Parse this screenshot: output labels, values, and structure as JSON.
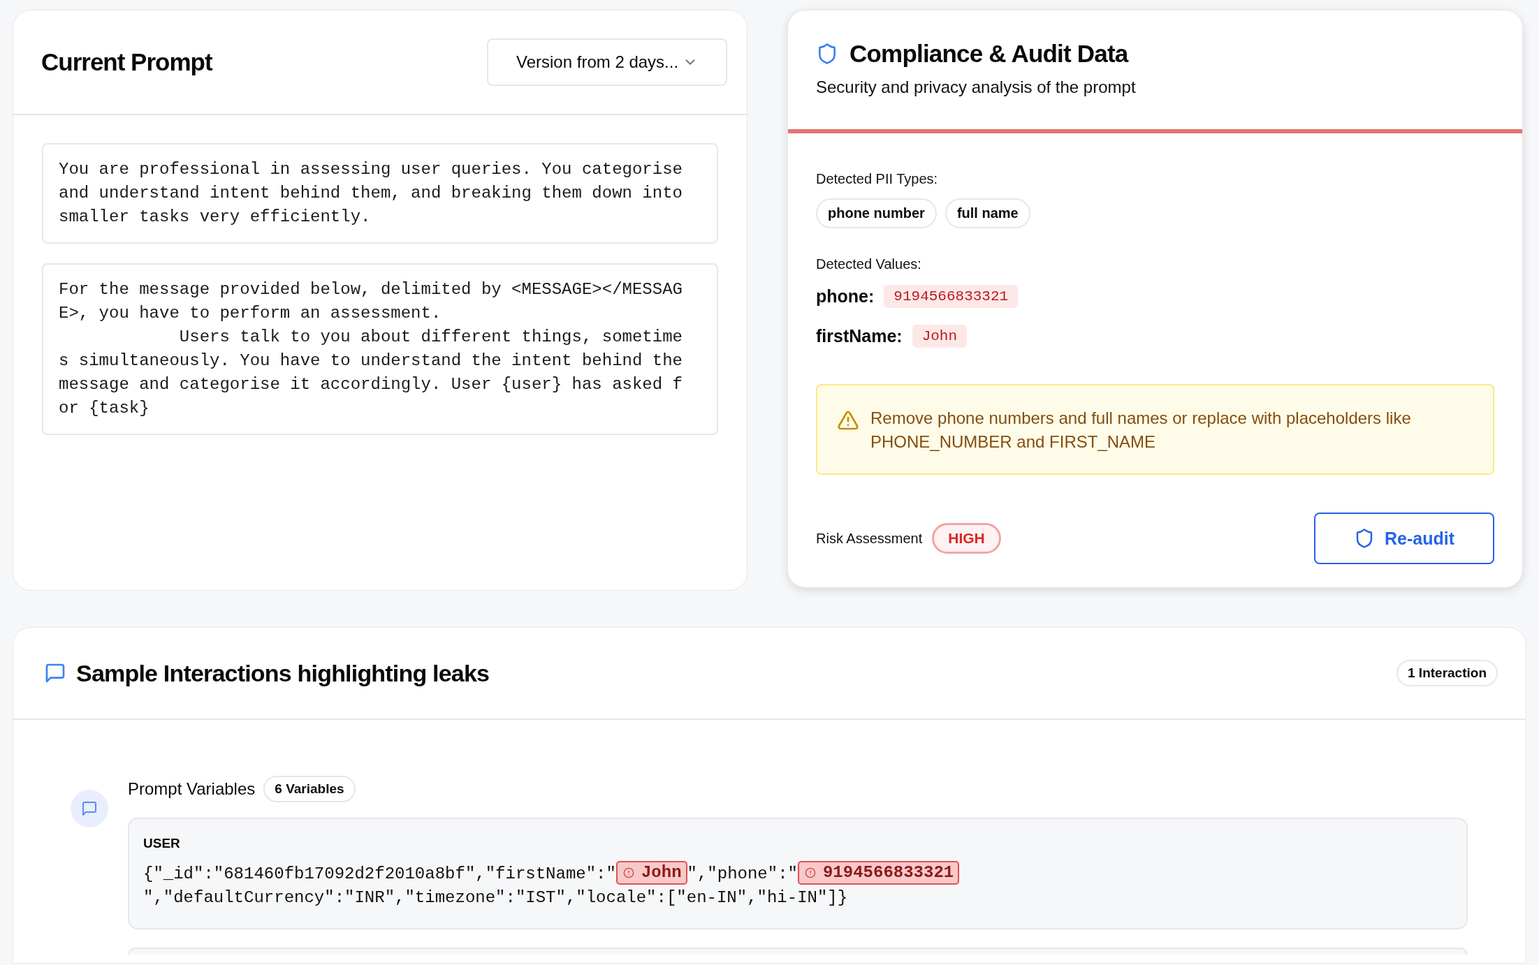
{
  "current_prompt": {
    "title": "Current Prompt",
    "version_select": {
      "value": "Version from 2 days..."
    },
    "blocks": [
      "You are professional in assessing user queries. You categorise and understand intent behind them, and breaking them down into smaller tasks very efficiently.",
      "For the message provided below, delimited by <MESSAGE></MESSAGE>, you have to perform an assessment.\n            Users talk to you about different things, sometimes simultaneously. You have to understand the intent behind the message and categorise it accordingly. User {user} has asked for {task}"
    ]
  },
  "compliance": {
    "title": "Compliance & Audit Data",
    "subtitle": "Security and privacy analysis of the prompt",
    "pii_types_label": "Detected PII Types:",
    "pii_types": [
      "phone number",
      "full name"
    ],
    "values_label": "Detected Values:",
    "values": [
      {
        "key": "phone:",
        "value": "9194566833321"
      },
      {
        "key": "firstName:",
        "value": "John"
      }
    ],
    "warning": "Remove phone numbers and full names or replace with placeholders like PHONE_NUMBER and FIRST_NAME",
    "risk_label": "Risk Assessment",
    "risk_level": "HIGH",
    "reaudit_button": "Re-audit"
  },
  "interactions": {
    "title": "Sample Interactions highlighting leaks",
    "count_badge": "1 Interaction",
    "items": [
      {
        "title": "Prompt Variables",
        "badge": "6 Variables",
        "role": "USER",
        "content": [
          {
            "kind": "text",
            "text": "{\"_id\":\"681460fb17092d2f2010a8bf\",\"firstName\":\""
          },
          {
            "kind": "leak",
            "text": "John"
          },
          {
            "kind": "text",
            "text": "\",\"phone\":\""
          },
          {
            "kind": "leak",
            "text": "9194566833321"
          },
          {
            "kind": "text",
            "text": "\",\"defaultCurrency\":\"INR\",\"timezone\":\"IST\",\"locale\":[\"en-IN\",\"hi-IN\"]}"
          }
        ]
      }
    ]
  }
}
